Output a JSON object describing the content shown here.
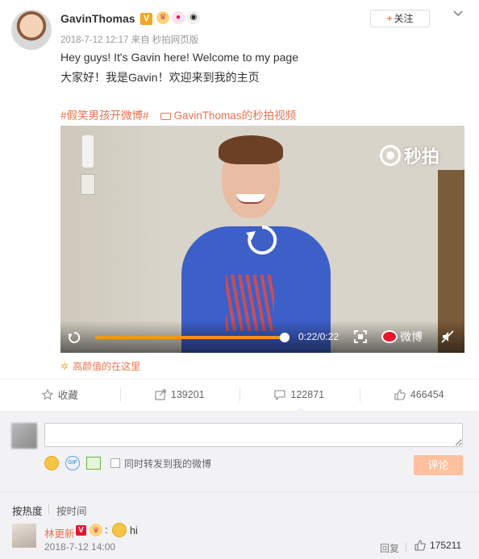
{
  "post": {
    "username": "GavinThomas",
    "verified_badge": "V",
    "badge_icons": [
      "crown-badge-icon",
      "pig-badge-icon",
      "panda-badge-icon"
    ],
    "meta": "2018-7-12 12:17 来自 秒拍网页版",
    "follow_label": "关注",
    "follow_plus": "+",
    "text_en": "Hey guys! It's Gavin here! Welcome to my page",
    "text_cn": "大家好！我是Gavin！欢迎来到我的主页",
    "topic_tag": "#假笑男孩开微博#",
    "video_link": "GavinThomas的秒拍视频",
    "beauty_link": "高颜值的在这里"
  },
  "video": {
    "watermark": "秒拍",
    "time": "0:22/0:22",
    "progress_fraction": 1.0,
    "weibo_label": "微博",
    "accent_color": "#f7931e"
  },
  "actions": {
    "favorite_label": "收藏",
    "repost_count": "139201",
    "comment_count": "122871",
    "like_count": "466454"
  },
  "comment_box": {
    "repost_checkbox_label": "同时转发到我的微博",
    "submit_label": "评论",
    "submit_color": "#ffc09f"
  },
  "sort": {
    "hot_label": "按热度",
    "time_label": "按时间"
  },
  "comments": [
    {
      "username": "林更新",
      "verified": "V",
      "colon": ":",
      "text": "hi",
      "time": "2018-7-12 14:00",
      "reply_label": "回复",
      "likes": "175211"
    }
  ],
  "colors": {
    "brand_orange": "#eb7350",
    "weibo_red": "#e6162d",
    "verified_orange": "#f5a623"
  }
}
